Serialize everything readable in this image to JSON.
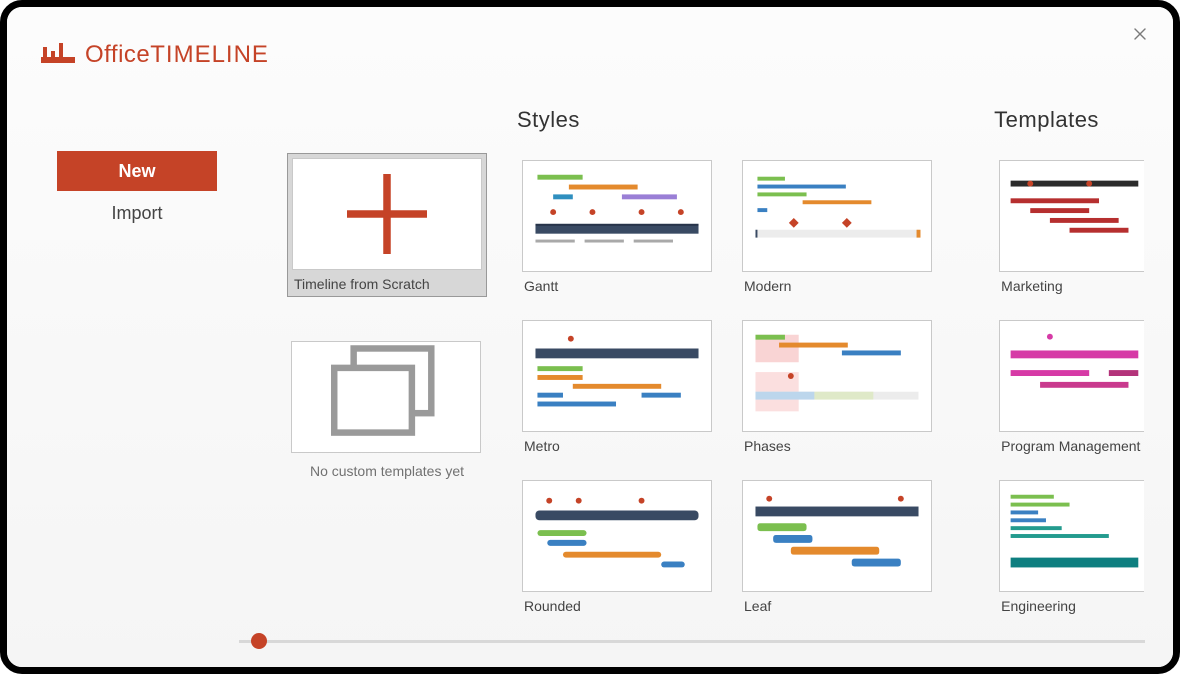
{
  "app": {
    "logo_thin": "Office",
    "logo_bold": "TIMELINE",
    "brand_color": "#c54327"
  },
  "close": {
    "aria": "Close"
  },
  "sidebar": {
    "items": [
      {
        "label": "New",
        "active": true
      },
      {
        "label": "Import",
        "active": false
      }
    ]
  },
  "scratch": {
    "card_label": "Timeline from Scratch",
    "empty_label": "No custom templates yet"
  },
  "styles": {
    "title": "Styles",
    "items": [
      {
        "label": "Gantt"
      },
      {
        "label": "Modern"
      },
      {
        "label": "Metro"
      },
      {
        "label": "Phases"
      },
      {
        "label": "Rounded"
      },
      {
        "label": "Leaf"
      }
    ]
  },
  "templates": {
    "title": "Templates",
    "items": [
      {
        "label": "Marketing"
      },
      {
        "label": "Program Management"
      },
      {
        "label": "Engineering"
      }
    ]
  }
}
